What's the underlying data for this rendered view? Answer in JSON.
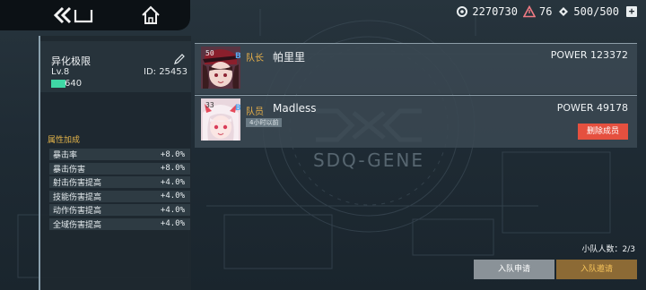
{
  "topbar": {
    "resources": [
      {
        "icon": "gear-currency-icon",
        "value": "2270730"
      },
      {
        "icon": "warning-triangle-icon",
        "value": "76"
      },
      {
        "icon": "diamond-ticket-icon",
        "value": "500/500"
      }
    ],
    "plus_label": "+"
  },
  "group": {
    "name": "异化极限",
    "level": "Lv.8",
    "id": "ID: 25453",
    "exp": "640",
    "exp_fraction": 0.2,
    "attr_title": "属性加成",
    "attributes": [
      {
        "name": "暴击率",
        "value": "+8.0%"
      },
      {
        "name": "暴击伤害",
        "value": "+8.0%"
      },
      {
        "name": "射击伤害提高",
        "value": "+4.0%"
      },
      {
        "name": "技能伤害提高",
        "value": "+4.0%"
      },
      {
        "name": "动作伤害提高",
        "value": "+4.0%"
      },
      {
        "name": "全域伤害提高",
        "value": "+4.0%"
      }
    ]
  },
  "members": [
    {
      "level": "50",
      "rank": "B",
      "role": "队长",
      "name": "帕里里",
      "power": "POWER 123372"
    },
    {
      "level": "33",
      "rank": "B",
      "role": "队员",
      "name": "Madless",
      "power": "POWER 49178",
      "last_online": "4小时以前",
      "remove_label": "删除成员"
    }
  ],
  "logo_text": "SDQ-GENE",
  "team_count": "小队人数：2/3",
  "buttons": {
    "apply": "入队申请",
    "invite": "入队邀请"
  },
  "colors": {
    "accent_gold": "#e8b04a",
    "danger": "#e5503f",
    "exp_green": "#3fd7a5",
    "rank_blue": "#58a8ee"
  }
}
